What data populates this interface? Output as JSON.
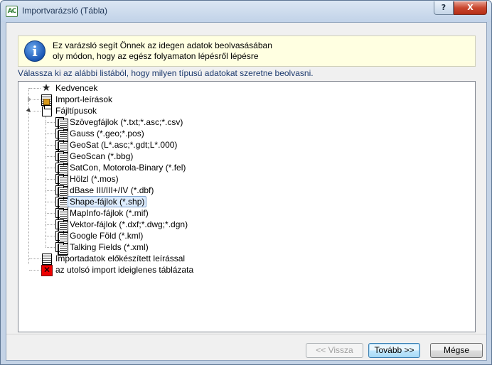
{
  "window": {
    "title": "Importvarázsló (Tábla)",
    "app_icon_text": "AC",
    "help_label": "?",
    "close_label": "X"
  },
  "info": {
    "icon_glyph": "i",
    "line1": "Ez varázsló segít Önnek az idegen adatok beolvasásában",
    "line2": "oly módon, hogy az egész folyamaton lépésről lépésre"
  },
  "instruction": "Válassza ki az alábbi listából, hogy milyen típusú adatokat szeretne beolvasni.",
  "tree": {
    "favorites": "Kedvencek",
    "import_descriptions": "Import-leírások",
    "file_types": "Fájltípusok",
    "file_type_items": [
      "Szövegfájlok (*.txt;*.asc;*.csv)",
      "Gauss (*.geo;*.pos)",
      "GeoSat (L*.asc;*.gdt;L*.000)",
      "GeoScan (*.bbg)",
      "SatCon, Motorola-Binary (*.fel)",
      "Hölzl (*.mos)",
      "dBase III/III+/IV (*.dbf)",
      "Shape-fájlok (*.shp)",
      "MapInfo-fájlok (*.mif)",
      "Vektor-fájlok (*.dxf;*.dwg;*.dgn)",
      "Google Föld (*.kml)",
      "Talking Fields (*.xml)"
    ],
    "selected_item": "Shape-fájlok (*.shp)",
    "prepared_import": "Importadatok előkészített leírással",
    "last_import": "az utolsó import ideiglenes táblázata"
  },
  "buttons": {
    "back": "<< Vissza",
    "next": "Tovább >>",
    "cancel": "Mégse"
  },
  "colors": {
    "info_background": "#ffffe1",
    "instruction_text": "#1c3a6e",
    "selection": "#dcebfc",
    "close_button": "#c9472f"
  }
}
